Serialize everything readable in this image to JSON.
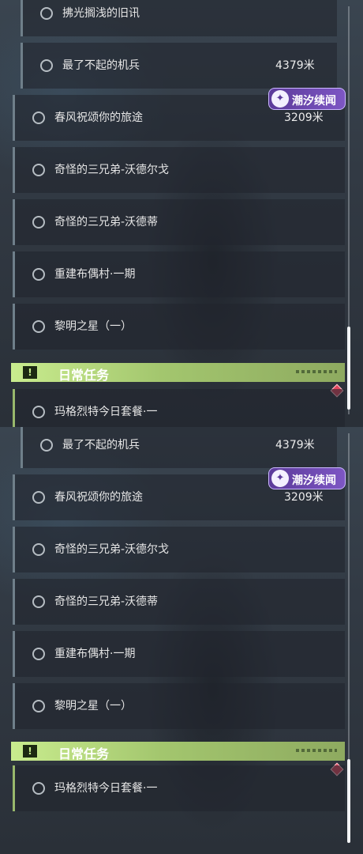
{
  "colors": {
    "quest_bar_accent": "#6f7f8a",
    "daily_accent": "#98b86c",
    "daily_header": "#c9ec8e",
    "badge_purple": "#6b47b0",
    "marker_red": "#e0475e"
  },
  "panels": [
    {
      "quests": [
        {
          "title": "拂光搁浅的旧讯",
          "distance": ""
        },
        {
          "title": "最了不起的机兵",
          "distance": "4379米"
        },
        {
          "title": "春风祝颂你的旅途",
          "distance": "3209米"
        },
        {
          "title": "奇怪的三兄弟-沃德尔戈",
          "distance": ""
        },
        {
          "title": "奇怪的三兄弟-沃德蒂",
          "distance": ""
        },
        {
          "title": "重建布偶村·一期",
          "distance": ""
        },
        {
          "title": "黎明之星（一）",
          "distance": ""
        }
      ],
      "badge": {
        "label": "潮汐续闻",
        "icon": "wave-emblem-icon"
      },
      "daily_header": {
        "title": "日常任务",
        "icon": "exclamation-icon"
      },
      "daily_quests": [
        {
          "title": "玛格烈特今日套餐·一"
        }
      ]
    },
    {
      "quests": [
        {
          "title": "最了不起的机兵",
          "distance": "4379米"
        },
        {
          "title": "春风祝颂你的旅途",
          "distance": "3209米"
        },
        {
          "title": "奇怪的三兄弟-沃德尔戈",
          "distance": ""
        },
        {
          "title": "奇怪的三兄弟-沃德蒂",
          "distance": ""
        },
        {
          "title": "重建布偶村·一期",
          "distance": ""
        },
        {
          "title": "黎明之星（一）",
          "distance": ""
        }
      ],
      "badge": {
        "label": "潮汐续闻",
        "icon": "wave-emblem-icon"
      },
      "daily_header": {
        "title": "日常任务",
        "icon": "exclamation-icon"
      },
      "daily_quests": [
        {
          "title": "玛格烈特今日套餐·一"
        }
      ]
    }
  ]
}
